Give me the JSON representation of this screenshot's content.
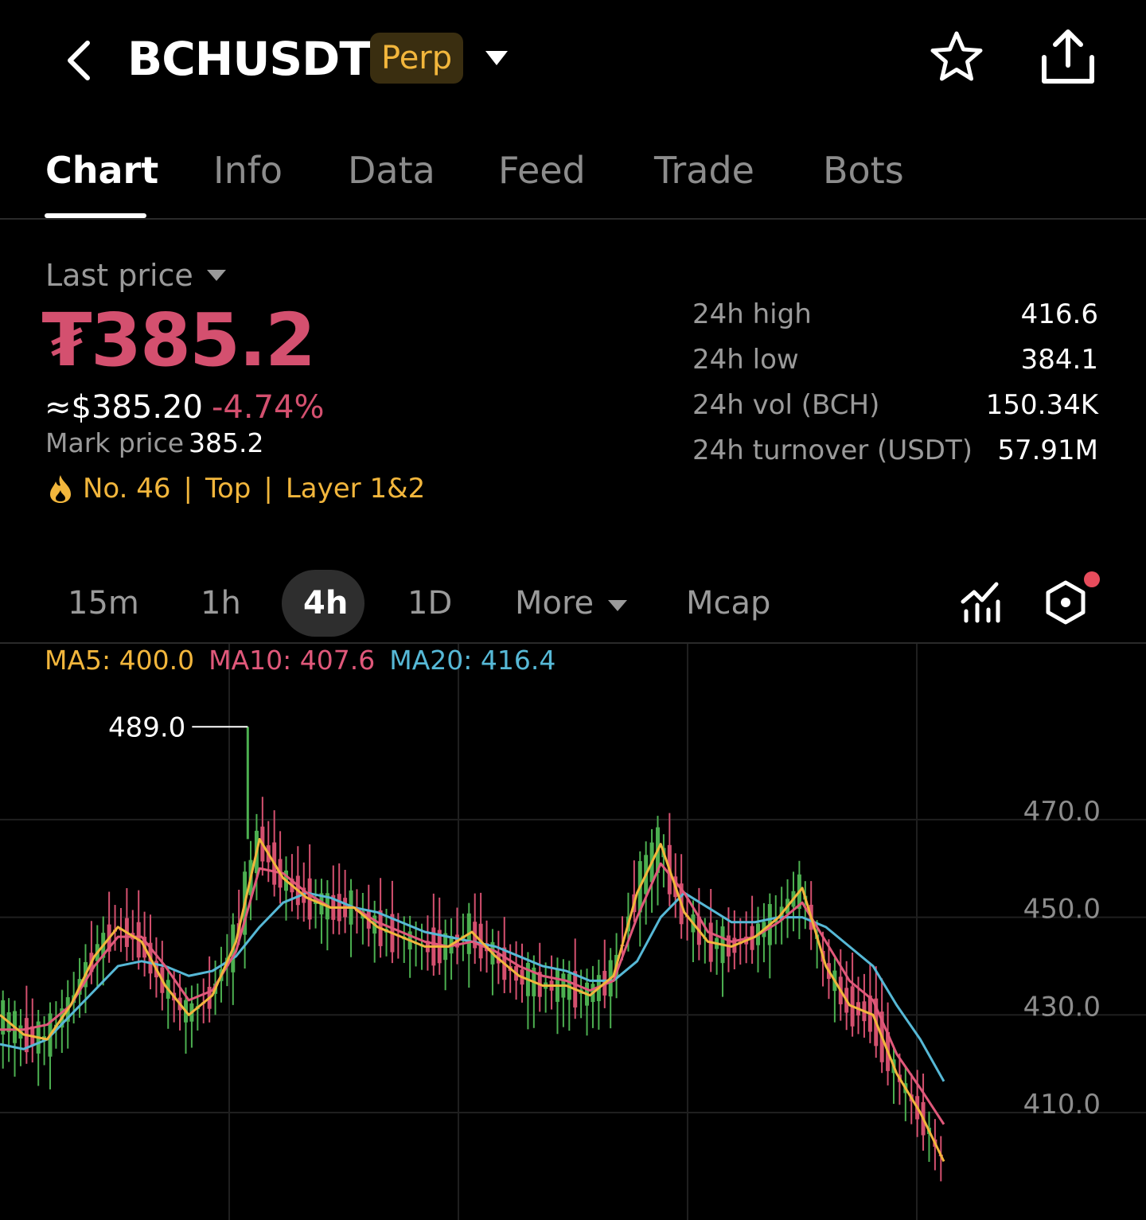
{
  "header": {
    "symbol": "BCHUSDT",
    "contract_type": "Perp",
    "back_icon": "chevron-left-icon",
    "dropdown_icon": "caret-down-icon",
    "favorite_icon": "star-outline-icon",
    "share_icon": "share-icon"
  },
  "tabs": [
    {
      "label": "Chart",
      "active": true
    },
    {
      "label": "Info"
    },
    {
      "label": "Data"
    },
    {
      "label": "Feed"
    },
    {
      "label": "Trade"
    },
    {
      "label": "Bots"
    }
  ],
  "price": {
    "label": "Last price",
    "last": "₮385.2",
    "usd": "≈$385.20",
    "change": "-4.74%",
    "mark_label": "Mark price",
    "mark_value": "385.2",
    "rank": "No. 46",
    "tag_top": "Top",
    "tag_layer": "Layer 1&2",
    "tags_icon": "flame-icon"
  },
  "stats": [
    {
      "label": "24h high",
      "value": "416.6"
    },
    {
      "label": "24h low",
      "value": "384.1"
    },
    {
      "label": "24h vol (BCH)",
      "value": "150.34K"
    },
    {
      "label": "24h turnover (USDT)",
      "value": "57.91M"
    }
  ],
  "intervals": {
    "items": [
      "15m",
      "1h",
      "4h",
      "1D"
    ],
    "active": "4h",
    "more": "More",
    "mcap": "Mcap",
    "indicator_icon": "chart-indicator-icon",
    "settings_icon": "hexagon-settings-icon"
  },
  "ma": {
    "ma5": "MA5: 400.0",
    "ma10": "MA10: 407.6",
    "ma20": "MA20: 416.4"
  },
  "colors": {
    "up": "#4caf50",
    "down": "#d4506f",
    "ma5": "#f2b63c",
    "ma10": "#e0587a",
    "ma20": "#56b8d6",
    "brand": "#f2b63c"
  },
  "chart_data": {
    "type": "candlestick",
    "y_axis_labels": [
      "470.0",
      "450.0",
      "430.0",
      "410.0"
    ],
    "y_ticks": [
      470,
      450,
      430,
      410
    ],
    "ylim": [
      388,
      506
    ],
    "max_annotation": {
      "label": "489.0",
      "value": 489.0
    },
    "ma5_values": [
      430,
      426,
      425,
      432,
      442,
      448,
      445,
      436,
      430,
      434,
      445,
      466,
      458,
      454,
      452,
      452,
      448,
      446,
      444,
      444,
      447,
      442,
      438,
      436,
      436,
      434,
      438,
      455,
      465,
      451,
      445,
      444,
      446,
      450,
      456,
      440,
      432,
      430,
      418,
      410,
      400
    ],
    "ma10_values": [
      427,
      427,
      428,
      432,
      440,
      446,
      446,
      440,
      433,
      435,
      443,
      460,
      459,
      455,
      452,
      452,
      449,
      447,
      445,
      444,
      445,
      443,
      440,
      438,
      437,
      435,
      437,
      450,
      461,
      455,
      447,
      445,
      446,
      449,
      453,
      445,
      437,
      433,
      422,
      415,
      407.6
    ],
    "ma20_values": [
      424,
      423,
      425,
      430,
      435,
      440,
      441,
      440,
      438,
      439,
      442,
      448,
      453,
      455,
      454,
      452,
      451,
      449,
      447,
      446,
      445,
      444,
      442,
      440,
      439,
      437,
      437,
      441,
      450,
      455,
      452,
      449,
      449,
      450,
      450,
      448,
      444,
      440,
      432,
      425,
      416.4
    ]
  }
}
